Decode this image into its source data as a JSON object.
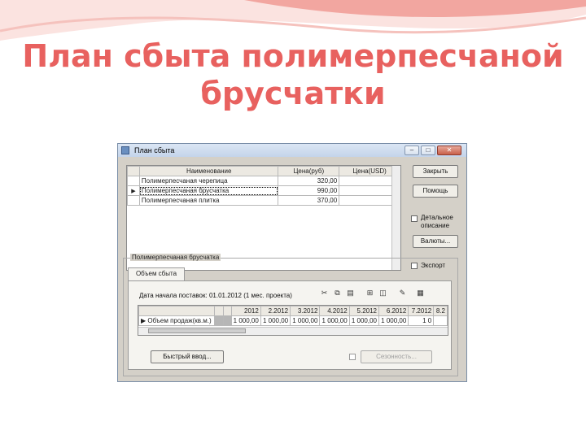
{
  "slide": {
    "title_line1": "План сбыта полимерпесчаной",
    "title_line2": "брусчатки"
  },
  "colors": {
    "title": "#e8615f",
    "accent_wave": "#f2a6a0"
  },
  "window": {
    "title": "План сбыта",
    "minimize_icon": "minimize-icon",
    "maximize_icon": "maximize-icon",
    "close_icon": "close-icon"
  },
  "products_table": {
    "headers": [
      "Наименование",
      "Цена(руб)",
      "Цена(USD)"
    ],
    "rows": [
      {
        "name": "Полимерпесчаная черепица",
        "price_rub": "320,00",
        "price_usd": ""
      },
      {
        "name": "Полимерпесчаная брусчатка",
        "price_rub": "990,00",
        "price_usd": ""
      },
      {
        "name": "Полимерпесчаная плитка",
        "price_rub": "370,00",
        "price_usd": ""
      }
    ]
  },
  "side_buttons": {
    "close": "Закрыть",
    "help": "Помощь",
    "detailed_label": "Детальное описание",
    "currency": "Валюты..."
  },
  "group": {
    "caption": "Полимерпесчаная брусчатка",
    "export_label": "Экспорт",
    "tab": "Объем сбыта",
    "period_label": "Дата начала поставок: 01.01.2012 (1 мес. проекта)",
    "grid": {
      "columns": [
        "",
        "",
        "2012",
        "2.2012",
        "3.2012",
        "4.2012",
        "5.2012",
        "6.2012",
        "7.2012",
        "8.2"
      ],
      "row_label": "Объем продаж(кв.м.)",
      "values": [
        "",
        "",
        "1 000,00",
        "1 000,00",
        "1 000,00",
        "1 000,00",
        "1 000,00",
        "1 000,00",
        "1 0"
      ]
    },
    "quick_input": "Быстрый ввод...",
    "seasonality": "Сезонность..."
  },
  "toolbar_icons": [
    "scissors-icon",
    "copy-icon",
    "paste-icon",
    "series-icon",
    "chart-icon",
    "pencil-icon",
    "grid-icon"
  ]
}
